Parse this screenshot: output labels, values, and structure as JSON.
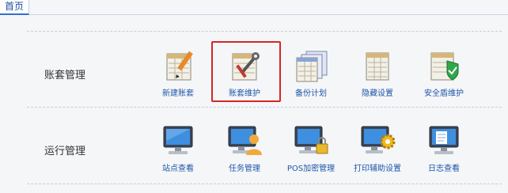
{
  "tabs": [
    {
      "label": "首页"
    }
  ],
  "sections": [
    {
      "label": "账套管理",
      "items": [
        {
          "label": "新建账套",
          "icon": "notebook-pencil-icon"
        },
        {
          "label": "账套维护",
          "icon": "notebook-wrench-icon",
          "selected": true
        },
        {
          "label": "备份计划",
          "icon": "stacked-notebooks-icon"
        },
        {
          "label": "隐藏设置",
          "icon": "notebook-icon"
        },
        {
          "label": "安全盾维护",
          "icon": "notebook-shield-icon"
        }
      ]
    },
    {
      "label": "运行管理",
      "items": [
        {
          "label": "站点查看",
          "icon": "monitor-icon"
        },
        {
          "label": "任务管理",
          "icon": "monitor-user-icon"
        },
        {
          "label": "POS加密管理",
          "icon": "monitor-lock-icon"
        },
        {
          "label": "打印辅助设置",
          "icon": "monitor-gear-icon"
        },
        {
          "label": "日志查看",
          "icon": "monitor-document-icon"
        }
      ]
    }
  ]
}
